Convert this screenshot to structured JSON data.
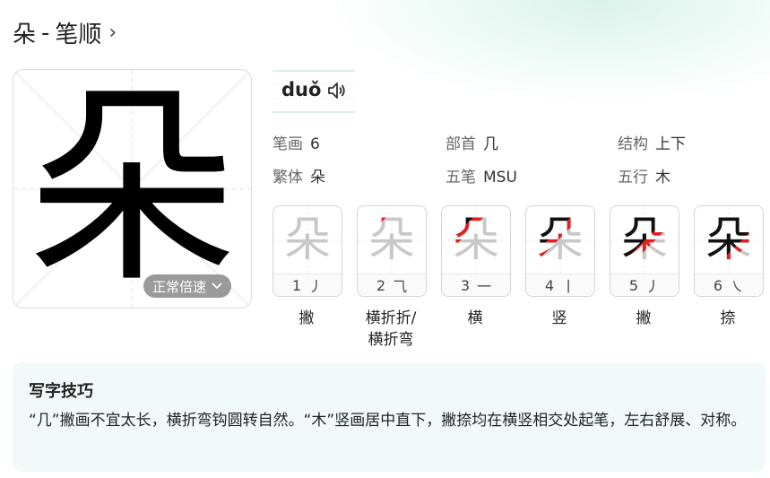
{
  "title": {
    "char": "朵",
    "separator": "-",
    "text": "笔顺",
    "chevron": "›"
  },
  "character": {
    "glyph": "朵",
    "speed_button": "正常倍速",
    "speed_icon": "chevron-down-icon"
  },
  "pinyin": {
    "text": "duǒ",
    "icon": "speaker-icon"
  },
  "info": {
    "strokes": {
      "label": "笔画",
      "value": "6"
    },
    "radical": {
      "label": "部首",
      "value": "几"
    },
    "structure": {
      "label": "结构",
      "value": "上下"
    },
    "traditional": {
      "label": "繁体",
      "value": "朵"
    },
    "wubi": {
      "label": "五笔",
      "value": "MSU"
    },
    "wuxing": {
      "label": "五行",
      "value": "木"
    }
  },
  "strokes": [
    {
      "num": "1",
      "shape": "丿",
      "name": "撇"
    },
    {
      "num": "2",
      "shape": "⺄",
      "name": "横折折/横折弯"
    },
    {
      "num": "3",
      "shape": "一",
      "name": "横"
    },
    {
      "num": "4",
      "shape": "丨",
      "name": "竖"
    },
    {
      "num": "5",
      "shape": "丿",
      "name": "撇"
    },
    {
      "num": "6",
      "shape": "㇏",
      "name": "捺"
    }
  ],
  "tips": {
    "heading": "写字技巧",
    "text": "“几”撇画不宜太长，横折弯钩圆转自然。“木”竖画居中直下，撇捺均在横竖相交处起笔，左右舒展、对称。"
  },
  "colors": {
    "highlight": "#e02020",
    "done": "#111111",
    "pending": "#c8c8c8",
    "accent_bg": "#f1faf8"
  }
}
